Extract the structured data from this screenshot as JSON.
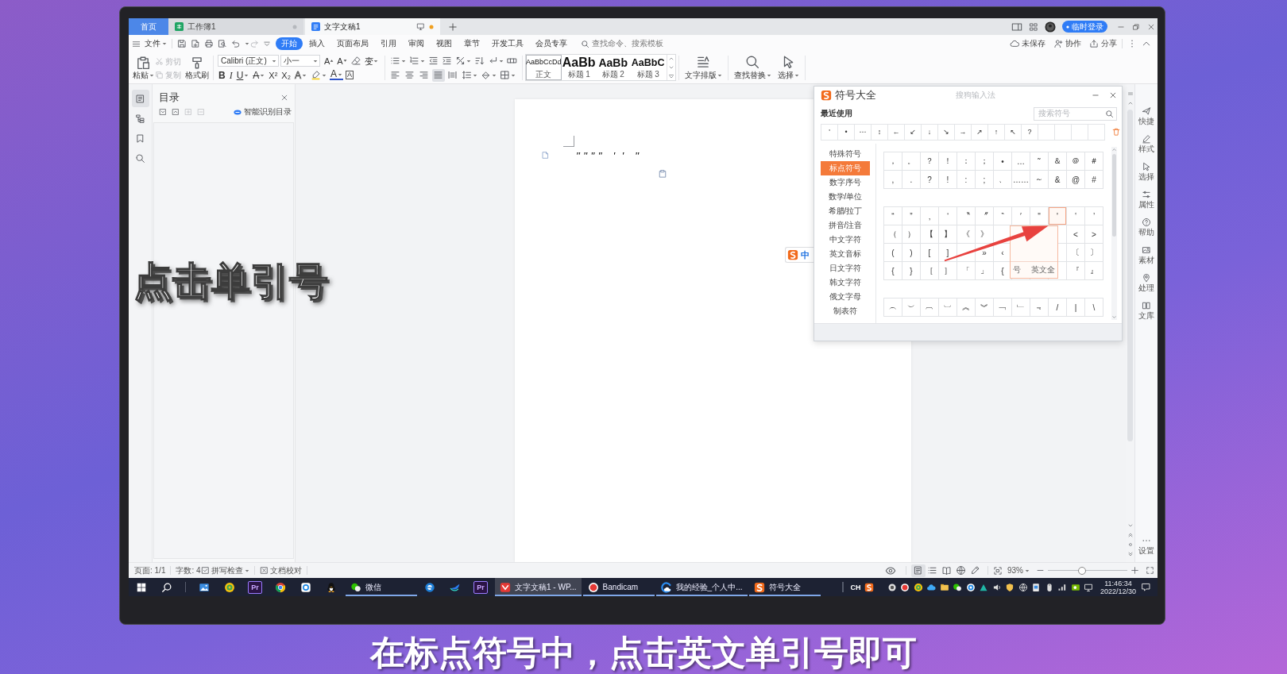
{
  "caption": "点击单引号",
  "subtitle": "在标点符号中，点击英文单引号即可",
  "tabs": [
    {
      "label": "首页",
      "kind": "home",
      "selected": false
    },
    {
      "label": "工作簿1",
      "kind": "sheet",
      "selected": false,
      "unsaved": false
    },
    {
      "label": "文字文稿1",
      "kind": "doc",
      "selected": true,
      "unsaved": true
    }
  ],
  "account": {
    "login": "临时登录"
  },
  "menu": {
    "file": "文件",
    "tabs": [
      {
        "label": "开始",
        "selected": true
      },
      {
        "label": "插入",
        "selected": false
      },
      {
        "label": "页面布局",
        "selected": false
      },
      {
        "label": "引用",
        "selected": false
      },
      {
        "label": "审阅",
        "selected": false
      },
      {
        "label": "视图",
        "selected": false
      },
      {
        "label": "章节",
        "selected": false
      },
      {
        "label": "开发工具",
        "selected": false
      },
      {
        "label": "会员专享",
        "selected": false
      }
    ],
    "search": {
      "placeholder": "查找命令、搜索模板"
    },
    "actions": [
      {
        "label": "未保存",
        "kind": "cloud"
      },
      {
        "label": "协作",
        "kind": "collab"
      },
      {
        "label": "分享",
        "kind": "share"
      }
    ]
  },
  "ribbon": {
    "clipboard": [
      {
        "label": "粘贴",
        "kind": "paste",
        "disabled": false
      },
      {
        "label": "剪切",
        "kind": "cut",
        "disabled": true
      },
      {
        "label": "复制",
        "kind": "copy",
        "disabled": true
      },
      {
        "label": "格式刷",
        "kind": "painter",
        "disabled": false
      }
    ],
    "font": {
      "name": "Calibri (正文)",
      "size": "小一"
    },
    "font_tools": [
      {
        "glyph": "A",
        "kind": "grow",
        "dropdown": false
      },
      {
        "glyph": "A",
        "kind": "shrink",
        "dropdown": false
      },
      {
        "kind": "eraser",
        "dropdown": false
      },
      {
        "glyph": "变",
        "kind": "phonetic",
        "dropdown": true
      }
    ],
    "format": [
      {
        "glyph": "B",
        "kind": "bold",
        "dropdown": false
      },
      {
        "glyph": "I",
        "kind": "italic",
        "dropdown": false
      },
      {
        "glyph": "U",
        "kind": "underline",
        "dropdown": true
      },
      {
        "glyph": "A",
        "kind": "strike",
        "dropdown": true
      },
      {
        "glyph": "X²",
        "kind": "sup",
        "dropdown": false
      },
      {
        "glyph": "X₂",
        "kind": "sub",
        "dropdown": false
      },
      {
        "glyph": "A",
        "kind": "effect",
        "dropdown": true
      },
      {
        "kind": "highlight",
        "dropdown": true
      },
      {
        "glyph": "A",
        "kind": "color",
        "dropdown": true
      },
      {
        "glyph": "A",
        "kind": "border",
        "dropdown": false
      }
    ],
    "paragraph": [
      {
        "kind": "bullets",
        "dropdown": true
      },
      {
        "kind": "numbering",
        "dropdown": true
      },
      {
        "kind": "outdent",
        "dropdown": false
      },
      {
        "kind": "indent",
        "dropdown": false
      },
      {
        "kind": "asian",
        "dropdown": true
      },
      {
        "kind": "sort",
        "dropdown": false
      },
      {
        "kind": "marks",
        "dropdown": true
      },
      {
        "kind": "tabs",
        "dropdown": false
      }
    ],
    "alignment": [
      {
        "kind": "left",
        "selected": false
      },
      {
        "kind": "center",
        "selected": false
      },
      {
        "kind": "right",
        "selected": false
      },
      {
        "kind": "justify",
        "selected": true
      },
      {
        "kind": "distribute",
        "selected": false
      }
    ],
    "paragraph_tools": [
      {
        "kind": "spacing",
        "dropdown": true
      },
      {
        "kind": "shading",
        "dropdown": true
      },
      {
        "kind": "borders",
        "dropdown": true
      }
    ],
    "styles": [
      {
        "sample": "AaBbCcDd",
        "label": "正文",
        "kind": "body",
        "selected": true
      },
      {
        "sample": "AaBb",
        "label": "标题 1",
        "kind": "h1",
        "selected": false
      },
      {
        "sample": "AaBb",
        "label": "标题 2",
        "kind": "h2",
        "selected": false
      },
      {
        "sample": "AaBbC",
        "label": "标题 3",
        "kind": "h3",
        "selected": false
      }
    ],
    "tools": [
      {
        "label": "文字排版",
        "kind": "layout"
      },
      {
        "label": "查找替换",
        "kind": "find"
      },
      {
        "label": "选择",
        "kind": "select"
      }
    ]
  },
  "nav": [
    {
      "kind": "toc",
      "selected": true
    },
    {
      "kind": "tree",
      "selected": false
    },
    {
      "kind": "bookmark",
      "selected": false
    },
    {
      "kind": "search",
      "selected": false
    }
  ],
  "toc": {
    "title": "目录",
    "smart": "智能识别目录",
    "tools": [
      {
        "kind": "expand",
        "disabled": false
      },
      {
        "kind": "collapse",
        "disabled": false
      },
      {
        "kind": "add",
        "disabled": true
      },
      {
        "kind": "remove",
        "disabled": true
      }
    ]
  },
  "document": {
    "text": "\"\"\"\"  ' '  \""
  },
  "ime": {
    "mode": "中"
  },
  "symbols": {
    "title": "符号大全",
    "source": "搜狗输入法",
    "recent_title": "最近使用",
    "search": {
      "placeholder": "搜索符号"
    },
    "recent": [
      "'",
      "•",
      "⋯",
      "↕",
      "←",
      "↙",
      "↓",
      "↘",
      "→",
      "↗",
      "↑",
      "↖",
      "?"
    ],
    "categories": [
      {
        "label": "特殊符号",
        "selected": false
      },
      {
        "label": "标点符号",
        "selected": true
      },
      {
        "label": "数字序号",
        "selected": false
      },
      {
        "label": "数学/单位",
        "selected": false
      },
      {
        "label": "希腊/拉丁",
        "selected": false
      },
      {
        "label": "拼音/注音",
        "selected": false
      },
      {
        "label": "中文字符",
        "selected": false
      },
      {
        "label": "英文音标",
        "selected": false
      },
      {
        "label": "日文字符",
        "selected": false
      },
      {
        "label": "韩文字符",
        "selected": false
      },
      {
        "label": "俄文字母",
        "selected": false
      },
      {
        "label": "制表符",
        "selected": false
      }
    ],
    "groups": [
      {
        "rows": [
          [
            {
              "symbol": "，",
              "selected": false
            },
            {
              "symbol": "。",
              "selected": false
            },
            {
              "symbol": "？",
              "selected": false
            },
            {
              "symbol": "！",
              "selected": false
            },
            {
              "symbol": "：",
              "selected": false
            },
            {
              "symbol": "；",
              "selected": false
            },
            {
              "symbol": "•",
              "selected": false
            },
            {
              "symbol": "…",
              "selected": false
            },
            {
              "symbol": "˜",
              "selected": false
            },
            {
              "symbol": "＆",
              "selected": false
            },
            {
              "symbol": "＠",
              "selected": false
            },
            {
              "symbol": "＃",
              "selected": false
            }
          ],
          [
            {
              "symbol": ",",
              "selected": false
            },
            {
              "symbol": ".",
              "selected": false
            },
            {
              "symbol": "?",
              "selected": false
            },
            {
              "symbol": "!",
              "selected": false
            },
            {
              "symbol": ":",
              "selected": false
            },
            {
              "symbol": ";",
              "selected": false
            },
            {
              "symbol": "、",
              "selected": false
            },
            {
              "symbol": "……",
              "selected": false
            },
            {
              "symbol": "～",
              "selected": false
            },
            {
              "symbol": "&",
              "selected": false
            },
            {
              "symbol": "@",
              "selected": false
            },
            {
              "symbol": "#",
              "selected": false
            }
          ]
        ]
      },
      {
        "rows": [
          [
            {
              "symbol": "“",
              "selected": false
            },
            {
              "symbol": "”",
              "selected": false
            },
            {
              "symbol": "‚",
              "selected": false
            },
            {
              "symbol": "‘",
              "selected": false
            },
            {
              "symbol": "〝",
              "selected": false
            },
            {
              "symbol": "〞",
              "selected": false
            },
            {
              "symbol": "‶",
              "selected": false
            },
            {
              "symbol": "′",
              "selected": false
            },
            {
              "symbol": "\"",
              "selected": false
            },
            {
              "symbol": "'",
              "selected": true
            },
            {
              "symbol": "‛",
              "selected": false
            },
            {
              "symbol": "’",
              "selected": false
            }
          ],
          [
            {
              "symbol": "（",
              "selected": false
            },
            {
              "symbol": "）",
              "selected": false
            },
            {
              "symbol": "【",
              "selected": false
            },
            {
              "symbol": "】",
              "selected": false
            },
            {
              "symbol": "《",
              "selected": false
            },
            {
              "symbol": "》",
              "selected": false
            },
            {
              "selected": false
            },
            null,
            null,
            {
              "selected": false
            },
            {
              "symbol": "<",
              "selected": false
            },
            {
              "symbol": ">",
              "selected": false
            }
          ],
          [
            {
              "symbol": "(",
              "selected": false
            },
            {
              "symbol": ")",
              "selected": false
            },
            {
              "symbol": "[",
              "selected": false
            },
            {
              "symbol": "]",
              "selected": false
            },
            {
              "selected": false
            },
            {
              "symbol": "»",
              "selected": false
            },
            {
              "symbol": "‹",
              "selected": false
            },
            null,
            null,
            {
              "selected": false
            },
            {
              "symbol": "〔",
              "selected": false
            },
            {
              "symbol": "〕",
              "selected": false
            }
          ],
          [
            {
              "symbol": "{",
              "selected": false
            },
            {
              "symbol": "}",
              "selected": false
            },
            {
              "symbol": "［",
              "selected": false
            },
            {
              "symbol": "］",
              "selected": false
            },
            {
              "symbol": "「",
              "selected": false
            },
            {
              "symbol": "」",
              "selected": false
            },
            {
              "symbol": "{",
              "selected": false
            },
            null,
            null,
            {
              "selected": false
            },
            {
              "symbol": "『",
              "selected": false
            },
            {
              "symbol": "』",
              "selected": false
            }
          ]
        ]
      },
      {
        "rows": [
          [
            {
              "symbol": "︵",
              "selected": false
            },
            {
              "symbol": "︶",
              "selected": false
            },
            {
              "symbol": "︹",
              "selected": false
            },
            {
              "symbol": "︺",
              "selected": false
            },
            {
              "symbol": "︽",
              "selected": false
            },
            {
              "symbol": "︾",
              "selected": false
            },
            {
              "symbol": "﹁",
              "selected": false
            },
            {
              "symbol": "﹂",
              "selected": false
            },
            {
              "symbol": "﹃",
              "selected": false
            },
            {
              "symbol": "/",
              "selected": false
            },
            {
              "symbol": "|",
              "selected": false
            },
            {
              "symbol": "\\",
              "selected": false
            }
          ]
        ]
      }
    ],
    "tooltip": {
      "name": "号",
      "kind_label": "英文全"
    }
  },
  "sidebar": {
    "items": [
      {
        "label": "快捷",
        "kind": "plane"
      },
      {
        "label": "样式",
        "kind": "pen"
      },
      {
        "label": "选择",
        "kind": "pointer"
      },
      {
        "label": "属性",
        "kind": "sliders"
      },
      {
        "label": "帮助",
        "kind": "help"
      },
      {
        "label": "素材",
        "kind": "image"
      },
      {
        "label": "处理",
        "kind": "pin"
      },
      {
        "label": "文库",
        "kind": "book"
      }
    ],
    "settings": "设置"
  },
  "status": {
    "page": "页面: 1/1",
    "words": "字数: 4",
    "spell": "拼写检查",
    "proof": "文档校对",
    "views": [
      {
        "kind": "page",
        "selected": true
      },
      {
        "kind": "outline",
        "selected": false
      },
      {
        "kind": "reading",
        "selected": false
      },
      {
        "kind": "web",
        "selected": false
      },
      {
        "kind": "write",
        "selected": false
      }
    ],
    "zoom": "93%",
    "zoom_slider": {
      "level": 0.43
    }
  },
  "taskbar": {
    "apps": [
      {
        "kind": "start",
        "running": false,
        "active": false
      },
      {
        "kind": "search",
        "running": false,
        "active": false
      },
      {
        "kind": "photos",
        "running": false,
        "active": false
      },
      {
        "kind": "music",
        "running": false,
        "active": false
      },
      {
        "kind": "premiere",
        "glyph": "Pr",
        "running": false,
        "active": false
      },
      {
        "kind": "chrome",
        "running": false,
        "active": false
      },
      {
        "kind": "qqbrowser",
        "running": false,
        "active": false
      },
      {
        "kind": "qq",
        "running": false,
        "active": false
      },
      {
        "kind": "wechat",
        "label": "微信",
        "running": true,
        "active": false
      },
      {
        "kind": "edge",
        "running": false,
        "active": false
      },
      {
        "kind": "lark",
        "running": false,
        "active": false
      },
      {
        "kind": "premiere",
        "glyph": "Pr",
        "running": false,
        "active": false
      },
      {
        "kind": "wps",
        "label": "文字文稿1 - WP...",
        "running": true,
        "active": true
      },
      {
        "kind": "bandicam",
        "label": "Bandicam",
        "running": true,
        "active": false
      },
      {
        "kind": "browser",
        "label": "我的经验_个人中...",
        "running": true,
        "active": false
      },
      {
        "kind": "sogou",
        "label": "符号大全",
        "running": true,
        "active": false
      }
    ],
    "lang": "CH",
    "tray": [
      {
        "kind": "camera"
      },
      {
        "kind": "record"
      },
      {
        "kind": "music"
      },
      {
        "kind": "cloud"
      },
      {
        "kind": "folder"
      },
      {
        "kind": "wechat"
      },
      {
        "kind": "ring"
      },
      {
        "kind": "triangle"
      },
      {
        "kind": "volume"
      },
      {
        "kind": "shield"
      },
      {
        "kind": "globe"
      },
      {
        "kind": "document"
      },
      {
        "kind": "mouse"
      },
      {
        "kind": "bars"
      },
      {
        "kind": "nvidia"
      },
      {
        "kind": "display"
      }
    ],
    "time": "11:46:34",
    "date": "2022/12/30"
  }
}
